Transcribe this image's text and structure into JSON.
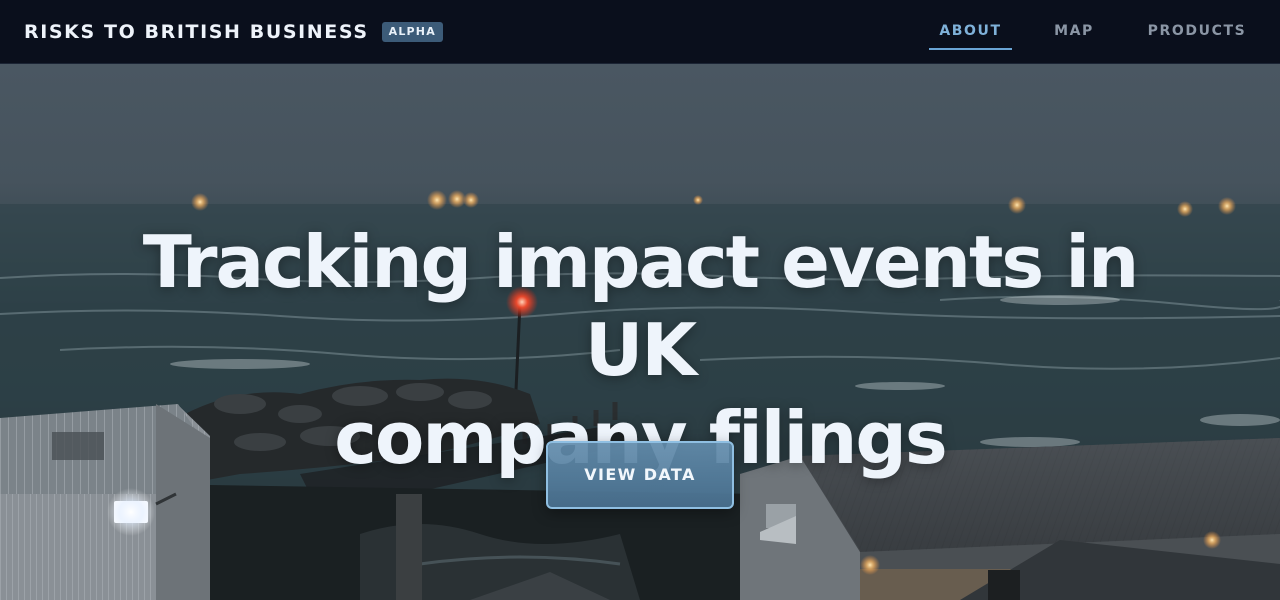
{
  "header": {
    "title": "RISKS TO BRITISH BUSINESS",
    "badge": "ALPHA",
    "nav": [
      {
        "label": "ABOUT",
        "active": true
      },
      {
        "label": "MAP",
        "active": false
      },
      {
        "label": "PRODUCTS",
        "active": false
      }
    ]
  },
  "hero": {
    "heading_line1": "Tracking impact events in UK",
    "heading_line2": "company filings",
    "cta_label": "VIEW DATA"
  },
  "colors": {
    "nav_background": "#0a0f1c",
    "accent": "#7fb1d9",
    "badge": "#3c5b78",
    "button_border": "#8fbfe2"
  }
}
